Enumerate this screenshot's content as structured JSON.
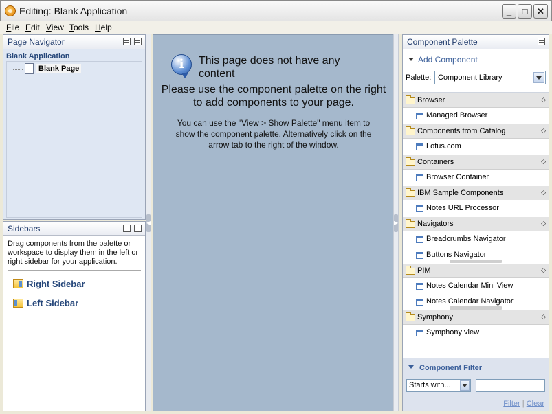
{
  "window": {
    "title": "Editing: Blank Application"
  },
  "menu": [
    "File",
    "Edit",
    "View",
    "Tools",
    "Help"
  ],
  "page_navigator": {
    "title": "Page Navigator",
    "app_name": "Blank Application",
    "page": "Blank Page"
  },
  "sidebars": {
    "title": "Sidebars",
    "description": "Drag components from the palette or workspace to display them in the left or right sidebar for your application.",
    "items": [
      "Right Sidebar",
      "Left Sidebar"
    ]
  },
  "workspace": {
    "heading": "This page does not have any content",
    "instruction": "Please use the component palette on the right to add components to your page.",
    "hint": "You can use the \"View > Show Palette\" menu item to show the component palette. Alternatively click on the arrow tab to the right of the window."
  },
  "palette": {
    "title": "Component Palette",
    "add_component": "Add Component",
    "palette_label": "Palette:",
    "palette_value": "Component Library",
    "categories": [
      {
        "name": "Browser",
        "items": [
          "Managed Browser"
        ]
      },
      {
        "name": "Components from Catalog",
        "items": [
          "Lotus.com"
        ]
      },
      {
        "name": "Containers",
        "items": [
          "Browser Container"
        ]
      },
      {
        "name": "IBM Sample Components",
        "items": [
          "Notes URL Processor"
        ]
      },
      {
        "name": "Navigators",
        "items": [
          "Breadcrumbs Navigator",
          "Buttons Navigator"
        ]
      },
      {
        "name": "PIM",
        "items": [
          "Notes Calendar Mini View",
          "Notes Calendar Navigator"
        ]
      },
      {
        "name": "Symphony",
        "items": [
          "Symphony view"
        ]
      }
    ],
    "filter": {
      "title": "Component Filter",
      "mode": "Starts with...",
      "value": "",
      "filter_link": "Filter",
      "separator": "|",
      "clear_link": "Clear"
    }
  }
}
